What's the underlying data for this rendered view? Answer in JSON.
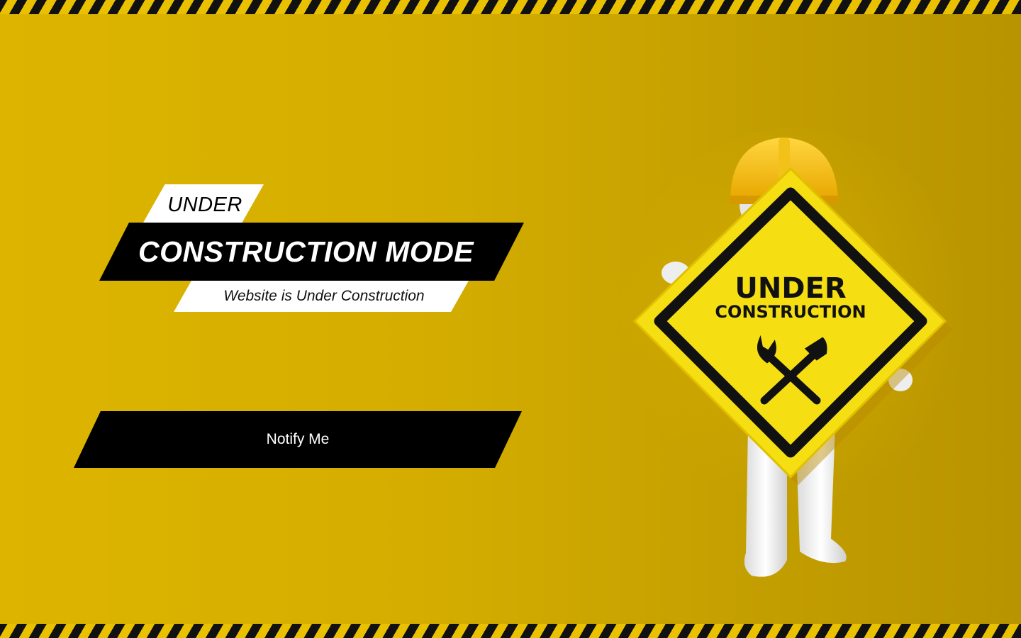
{
  "headline": {
    "line1": "UNDER",
    "line2": "CONSTRUCTION MODE",
    "subtitle": "Website is Under Construction"
  },
  "actions": {
    "notify_label": "Notify Me"
  },
  "illustration": {
    "sign_line1": "UNDER",
    "sign_line2": "CONSTRUCTION",
    "icon": "wrench-hammer-icon"
  },
  "colors": {
    "background": "#d3ac00",
    "stripe_dark": "#111111",
    "stripe_light": "#e9c100",
    "button": "#000000",
    "sign_yellow": "#f7e11a"
  }
}
